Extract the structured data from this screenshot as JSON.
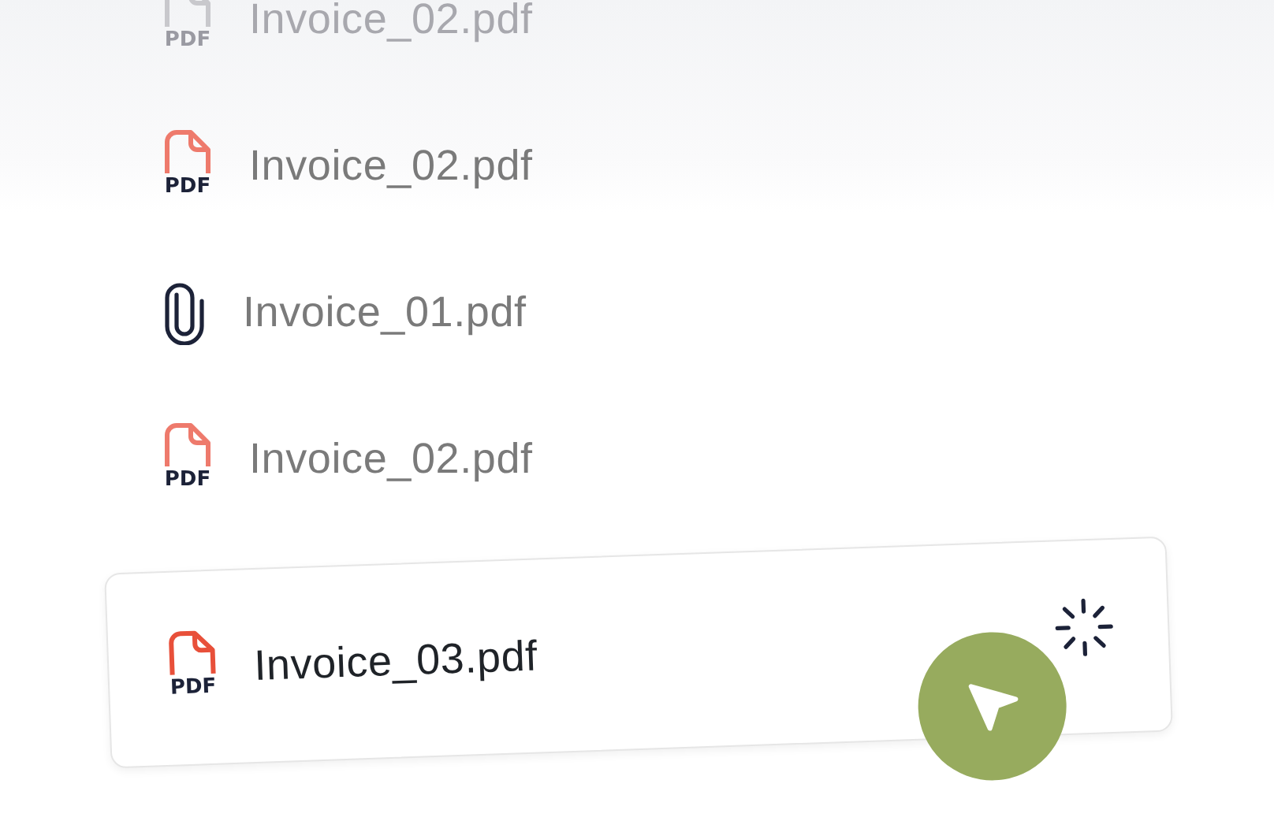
{
  "files": [
    {
      "name": "Invoice_02.pdf",
      "kind": "pdf",
      "badge": "PDF",
      "dimmed": true,
      "selected": false
    },
    {
      "name": "Invoice_02.pdf",
      "kind": "pdf",
      "badge": "PDF",
      "dimmed": false,
      "selected": false
    },
    {
      "name": "Invoice_01.pdf",
      "kind": "attachment",
      "dimmed": false,
      "selected": false
    },
    {
      "name": "Invoice_02.pdf",
      "kind": "pdf",
      "badge": "PDF",
      "dimmed": false,
      "selected": false
    },
    {
      "name": "Invoice_03.pdf",
      "kind": "pdf",
      "badge": "PDF",
      "dimmed": false,
      "selected": true,
      "loading": true
    }
  ]
}
